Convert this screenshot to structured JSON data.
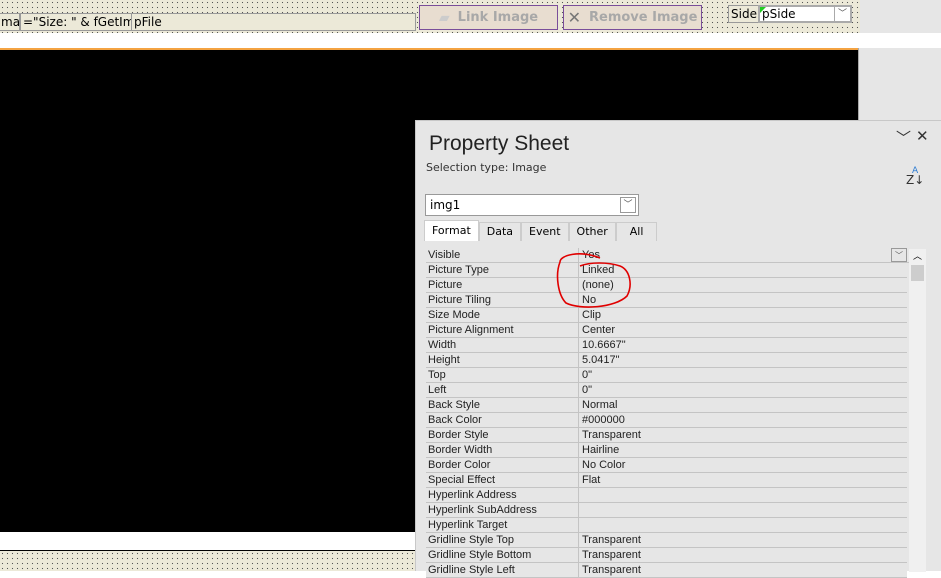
{
  "toolbar": {
    "field1": "mag",
    "field2": "=\"Size: \" & fGetIma",
    "field3": "pFile",
    "link_image": "Link Image",
    "remove_image": "Remove Image",
    "side_label": "Side",
    "side_value": "pSide"
  },
  "property_sheet": {
    "title": "Property Sheet",
    "selection_type": "Selection type:  Image",
    "object": "img1",
    "tabs": [
      "Format",
      "Data",
      "Event",
      "Other",
      "All"
    ],
    "rows": [
      {
        "name": "Visible",
        "value": "Yes"
      },
      {
        "name": "Picture Type",
        "value": "Linked"
      },
      {
        "name": "Picture",
        "value": "(none)"
      },
      {
        "name": "Picture Tiling",
        "value": "No"
      },
      {
        "name": "Size Mode",
        "value": "Clip"
      },
      {
        "name": "Picture Alignment",
        "value": "Center"
      },
      {
        "name": "Width",
        "value": "10.6667\""
      },
      {
        "name": "Height",
        "value": "5.0417\""
      },
      {
        "name": "Top",
        "value": "0\""
      },
      {
        "name": "Left",
        "value": "0\""
      },
      {
        "name": "Back Style",
        "value": "Normal"
      },
      {
        "name": "Back Color",
        "value": "#000000"
      },
      {
        "name": "Border Style",
        "value": "Transparent"
      },
      {
        "name": "Border Width",
        "value": "Hairline"
      },
      {
        "name": "Border Color",
        "value": "No Color"
      },
      {
        "name": "Special Effect",
        "value": "Flat"
      },
      {
        "name": "Hyperlink Address",
        "value": ""
      },
      {
        "name": "Hyperlink SubAddress",
        "value": ""
      },
      {
        "name": "Hyperlink Target",
        "value": ""
      },
      {
        "name": "Gridline Style Top",
        "value": "Transparent"
      },
      {
        "name": "Gridline Style Bottom",
        "value": "Transparent"
      },
      {
        "name": "Gridline Style Left",
        "value": "Transparent"
      }
    ]
  },
  "colors": {
    "annotation": "#e00000",
    "accent": "#f4a342"
  }
}
